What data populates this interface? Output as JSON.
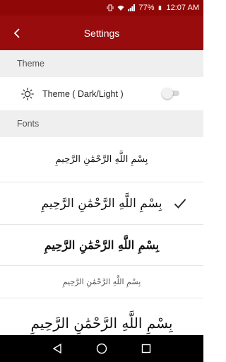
{
  "status_bar": {
    "battery": "77%",
    "time": "12:07 AM"
  },
  "app_bar": {
    "title": "Settings",
    "back_icon": "back-arrow-icon"
  },
  "sections": {
    "theme": {
      "header": "Theme",
      "toggle_label": "Theme ( Dark/Light )",
      "toggle_on": false,
      "icon": "sun-icon"
    },
    "fonts": {
      "header": "Fonts",
      "items": [
        {
          "text": "بِسْمِ اللَّهِ الرَّحْمَٰنِ الرَّحِيمِ",
          "selected": false
        },
        {
          "text": "بِسْمِ اللَّهِ الرَّحْمَٰنِ الرَّحِيمِ",
          "selected": true
        },
        {
          "text": "بِسْمِ اللَّهِ الرَّحْمَٰنِ الرَّحِيمِ",
          "selected": false
        },
        {
          "text": "بِسْمِ اللَّهِ الرَّحْمَٰنِ الرَّحِيمِ",
          "selected": false
        },
        {
          "text": "بِسْمِ اللَّهِ الرَّحْمَٰنِ الرَّحِيمِ",
          "selected": false
        }
      ]
    }
  },
  "colors": {
    "app_bar": "#980c0d",
    "status_bar": "#8f0707",
    "section_bg": "#efefef"
  }
}
